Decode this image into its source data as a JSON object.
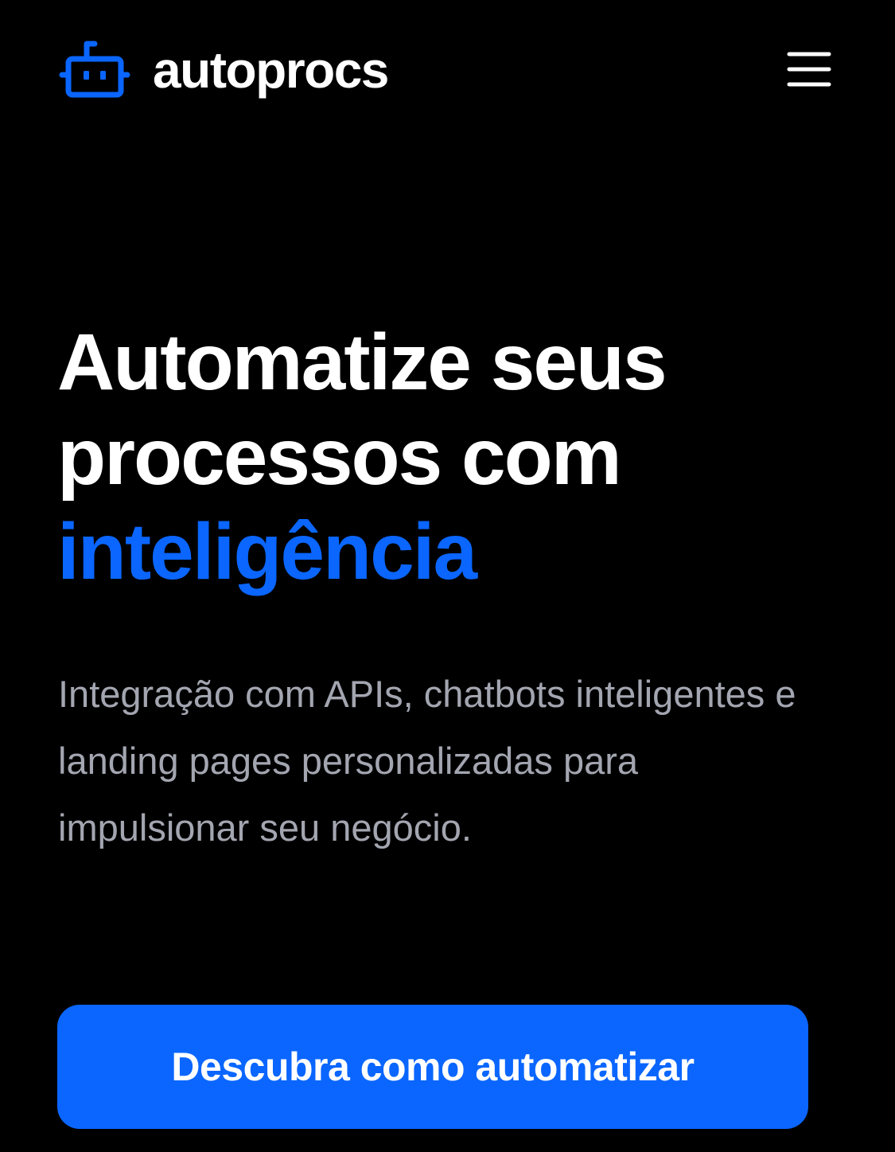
{
  "header": {
    "brand_name": "autoprocs",
    "logo_icon": "robot-icon",
    "menu_icon": "hamburger-menu-icon"
  },
  "hero": {
    "title_line_1": "Automatize seus",
    "title_line_2": "processos com",
    "title_highlight": "inteligência",
    "subtitle": "Integração com APIs, chatbots inteligentes e landing pages personalizadas para impulsionar seu negócio.",
    "cta_label": "Descubra como automatizar"
  },
  "colors": {
    "background": "#000000",
    "accent": "#0a66ff",
    "text": "#ffffff",
    "muted_text": "#a3a6b0"
  }
}
